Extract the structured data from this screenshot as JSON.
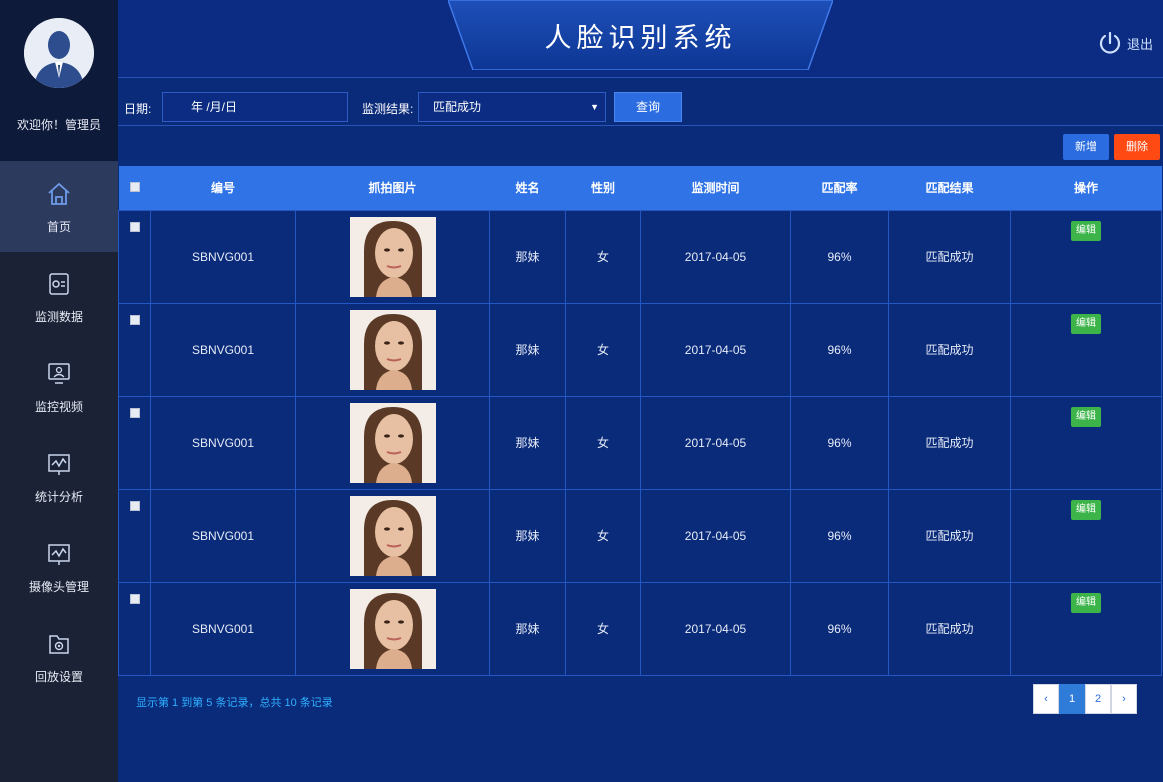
{
  "app": {
    "title": "人脸识别系统"
  },
  "header": {
    "logout_label": "退出"
  },
  "user": {
    "welcome": "欢迎你！管理员"
  },
  "sidebar": {
    "items": [
      {
        "label": "首页",
        "icon": "home-icon",
        "active": true
      },
      {
        "label": "监测数据",
        "icon": "data-monitor-icon",
        "active": false
      },
      {
        "label": "监控视频",
        "icon": "video-monitor-icon",
        "active": false
      },
      {
        "label": "统计分析",
        "icon": "statistics-icon",
        "active": false
      },
      {
        "label": "摄像头管理",
        "icon": "camera-manage-icon",
        "active": false
      },
      {
        "label": "回放设置",
        "icon": "playback-settings-icon",
        "active": false
      }
    ]
  },
  "filter": {
    "date_label": "日期:",
    "date_value": "年 /月/日",
    "result_label": "监测结果:",
    "result_value": "匹配成功",
    "query_label": "查询"
  },
  "actions": {
    "add_label": "新增",
    "delete_label": "删除"
  },
  "table": {
    "headers": [
      "编号",
      "抓拍图片",
      "姓名",
      "性别",
      "监测时间",
      "匹配率",
      "匹配结果",
      "操作"
    ],
    "rows": [
      {
        "id": "SBNVG001",
        "name": "那妹",
        "gender": "女",
        "time": "2017-04-05",
        "rate": "96%",
        "result": "匹配成功",
        "edit": "编辑"
      },
      {
        "id": "SBNVG001",
        "name": "那妹",
        "gender": "女",
        "time": "2017-04-05",
        "rate": "96%",
        "result": "匹配成功",
        "edit": "编辑"
      },
      {
        "id": "SBNVG001",
        "name": "那妹",
        "gender": "女",
        "time": "2017-04-05",
        "rate": "96%",
        "result": "匹配成功",
        "edit": "编辑"
      },
      {
        "id": "SBNVG001",
        "name": "那妹",
        "gender": "女",
        "time": "2017-04-05",
        "rate": "96%",
        "result": "匹配成功",
        "edit": "编辑"
      },
      {
        "id": "SBNVG001",
        "name": "那妹",
        "gender": "女",
        "time": "2017-04-05",
        "rate": "96%",
        "result": "匹配成功",
        "edit": "编辑"
      }
    ]
  },
  "pagination": {
    "summary": "显示第 1 到第 5 条记录，总共 10 条记录",
    "prev": "‹",
    "pages": [
      "1",
      "2"
    ],
    "next": "›",
    "current": "1"
  },
  "colors": {
    "background": "#0a2a7a",
    "sidebar": "#1b2236",
    "header_row": "#2f73e6",
    "primary_button": "#2b6de0",
    "delete_button": "#ff4a14",
    "edit_button": "#3cb44a",
    "summary_text": "#2fb0ff"
  }
}
